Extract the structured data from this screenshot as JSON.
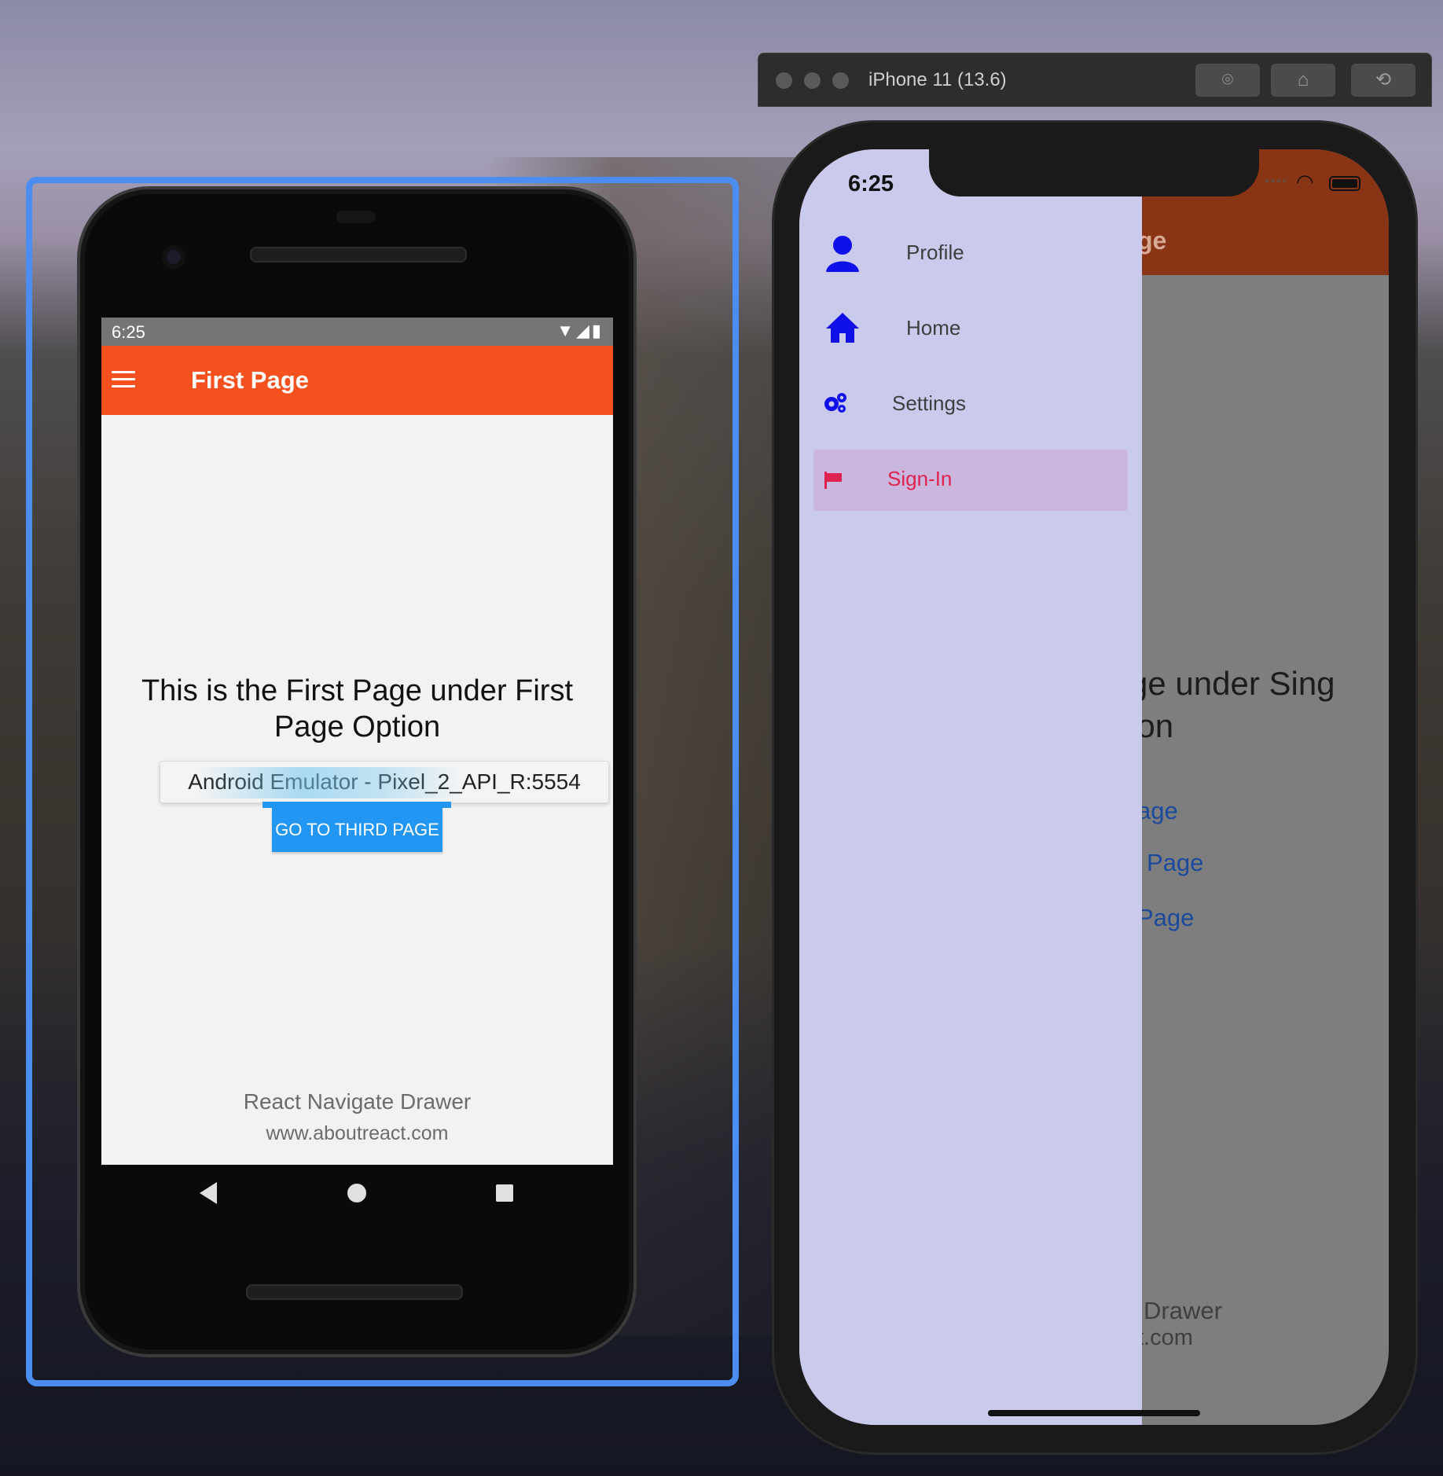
{
  "android": {
    "status_time": "6:25",
    "appbar_title": "First Page",
    "body_title": "This is the First Page under First Page Option",
    "tooltip": "Android Emulator - Pixel_2_API_R:5554",
    "button_label": "GO TO THIRD PAGE",
    "footer_title": "React Navigate Drawer",
    "footer_url": "www.aboutreact.com",
    "icons": [
      "hamburger-icon",
      "wifi-icon",
      "signal-icon",
      "battery-icon",
      "back-icon",
      "home-icon",
      "recents-icon"
    ],
    "appbar_color": "#f4511e",
    "button_color": "#2196f3"
  },
  "simulator": {
    "window_title": "iPhone 11 (13.6)",
    "toolbar_icons": [
      "screenshot-icon",
      "home-icon",
      "rotate-icon"
    ]
  },
  "ios": {
    "status_time": "6:25",
    "header_partial": "ge",
    "under_line1": "ge under Sing",
    "under_line2": "ion",
    "links": [
      "age",
      "Page",
      "Page"
    ],
    "footer_line1": "Drawer",
    "footer_line2": "t.com",
    "drawer": {
      "items": [
        {
          "label": "Profile",
          "icon": "user-icon",
          "active": false
        },
        {
          "label": "Home",
          "icon": "home-icon",
          "active": false
        },
        {
          "label": "Settings",
          "icon": "gears-icon",
          "active": false
        },
        {
          "label": "Sign-In",
          "icon": "flag-icon",
          "active": true
        }
      ],
      "background": "#cacaed",
      "active_color": "#e0224f"
    },
    "header_color": "#8a3416"
  }
}
